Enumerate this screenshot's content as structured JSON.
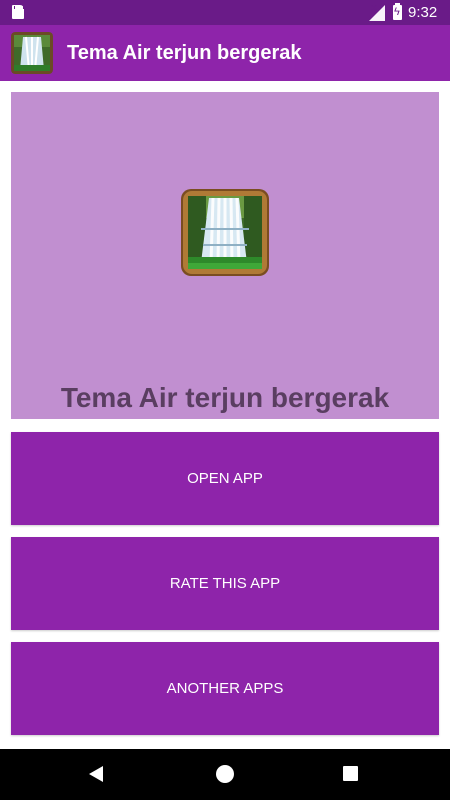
{
  "status_bar": {
    "time": "9:32",
    "icons": [
      "sd-card-icon",
      "signal-off-icon",
      "battery-charging-icon"
    ]
  },
  "app_bar": {
    "title": "Tema Air terjun bergerak",
    "icon": "waterfall-app-icon",
    "color": "#8e24aa"
  },
  "hero": {
    "title": "Tema Air terjun bergerak",
    "icon": "waterfall-app-icon",
    "background": "#c18fd0"
  },
  "buttons": {
    "open": "OPEN APP",
    "rate": "RATE THIS APP",
    "another": "ANOTHER APPS"
  },
  "nav_bar": {
    "icons": [
      "back-icon",
      "home-icon",
      "recents-icon"
    ]
  },
  "colors": {
    "status_bar": "#6a1b88",
    "primary": "#8e24aa",
    "hero_bg": "#c18fd0",
    "hero_text": "#5a3e61"
  }
}
